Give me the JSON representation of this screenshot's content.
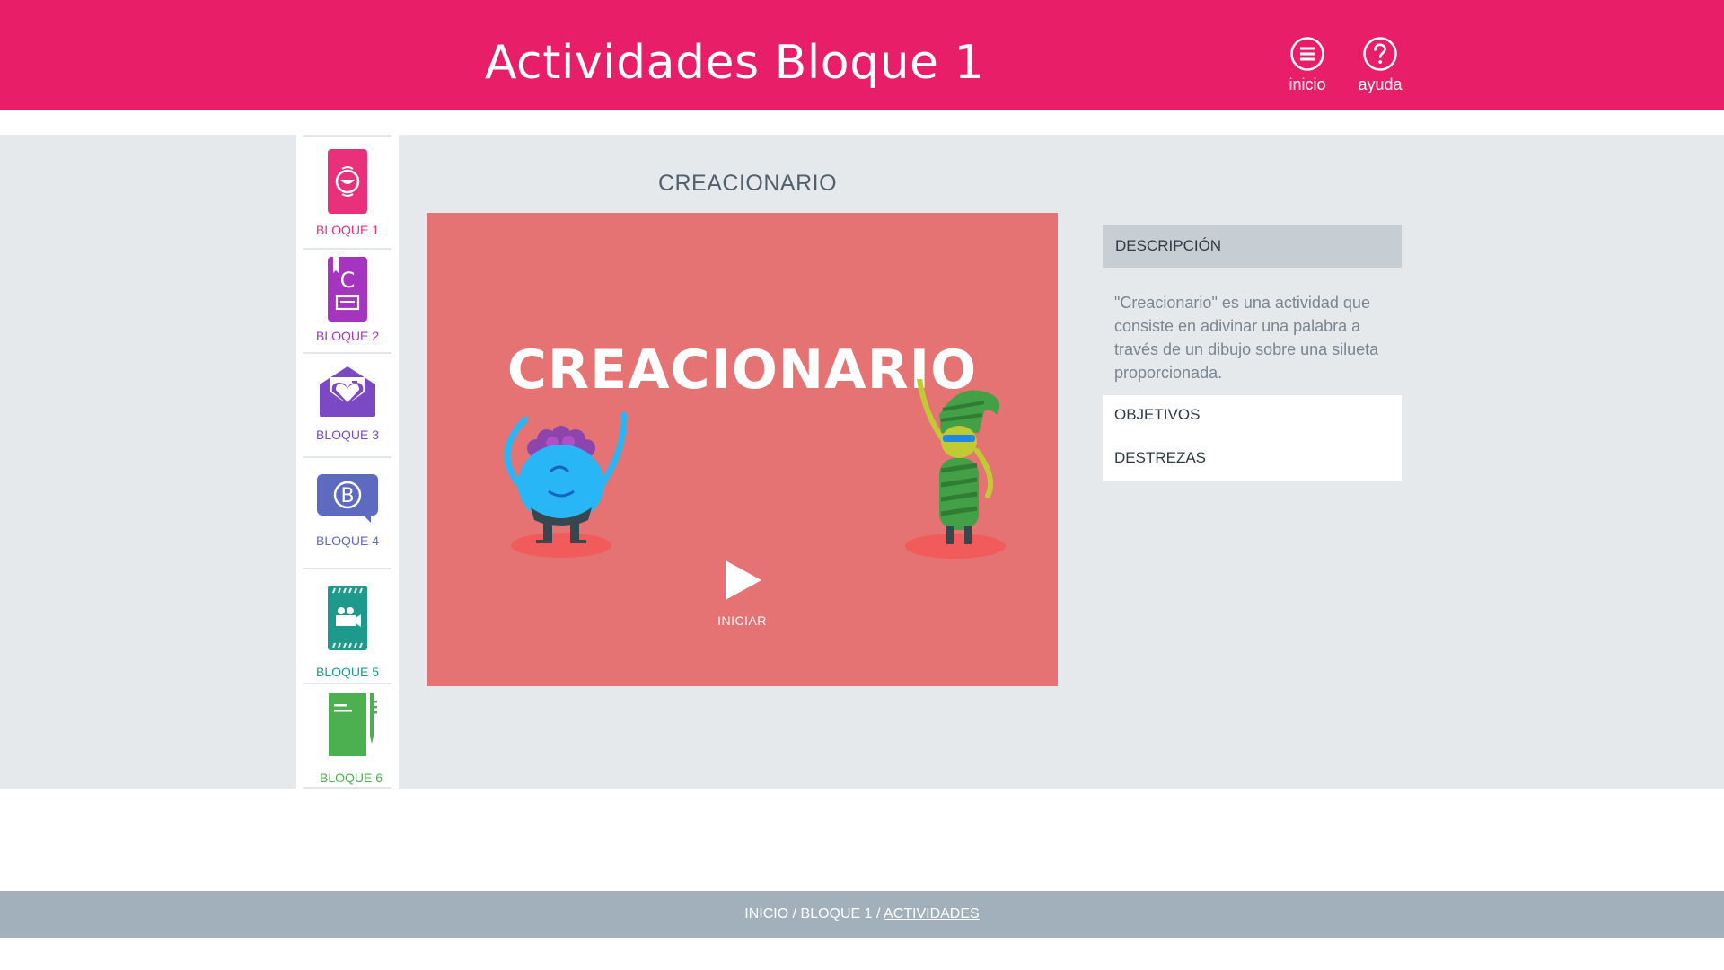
{
  "header": {
    "title": "Actividades Bloque 1",
    "inicio_label": "inicio",
    "ayuda_label": "ayuda"
  },
  "sidebar": {
    "items": [
      {
        "label": "BLOQUE 1",
        "color": "#e8317a",
        "icon": "card-with-face-icon"
      },
      {
        "label": "BLOQUE 2",
        "color": "#a534bf",
        "icon": "book-with-letter-c-icon"
      },
      {
        "label": "BLOQUE 3",
        "color": "#7b49c3",
        "icon": "envelope-with-heart-icon"
      },
      {
        "label": "BLOQUE 4",
        "color": "#5c6bc0",
        "icon": "speech-bubble-b-icon"
      },
      {
        "label": "BLOQUE 5",
        "color": "#1d9a8c",
        "icon": "film-camera-icon"
      },
      {
        "label": "BLOQUE 6",
        "color": "#4caf50",
        "icon": "notebook-with-pen-icon"
      }
    ]
  },
  "activity": {
    "title": "CREACIONARIO",
    "logo_text": "CREACIONARIO",
    "play_label": "INICIAR",
    "background_color": "#e57373"
  },
  "panel": {
    "description_header": "DESCRIPCIÓN",
    "description_text": "\"Creacionario\" es una actividad que consiste en adivinar una palabra a través de un dibujo sobre una silueta proporcionada.",
    "objetivos_label": "OBJETIVOS",
    "destrezas_label": "DESTREZAS"
  },
  "breadcrumb": {
    "part1": "INICIO",
    "sep": " / ",
    "part2": "BLOQUE 1",
    "current": "ACTIVIDADES"
  },
  "colors": {
    "header": "#e81f68",
    "footer": "#a1b0ba",
    "band": "#e6e9ec"
  }
}
